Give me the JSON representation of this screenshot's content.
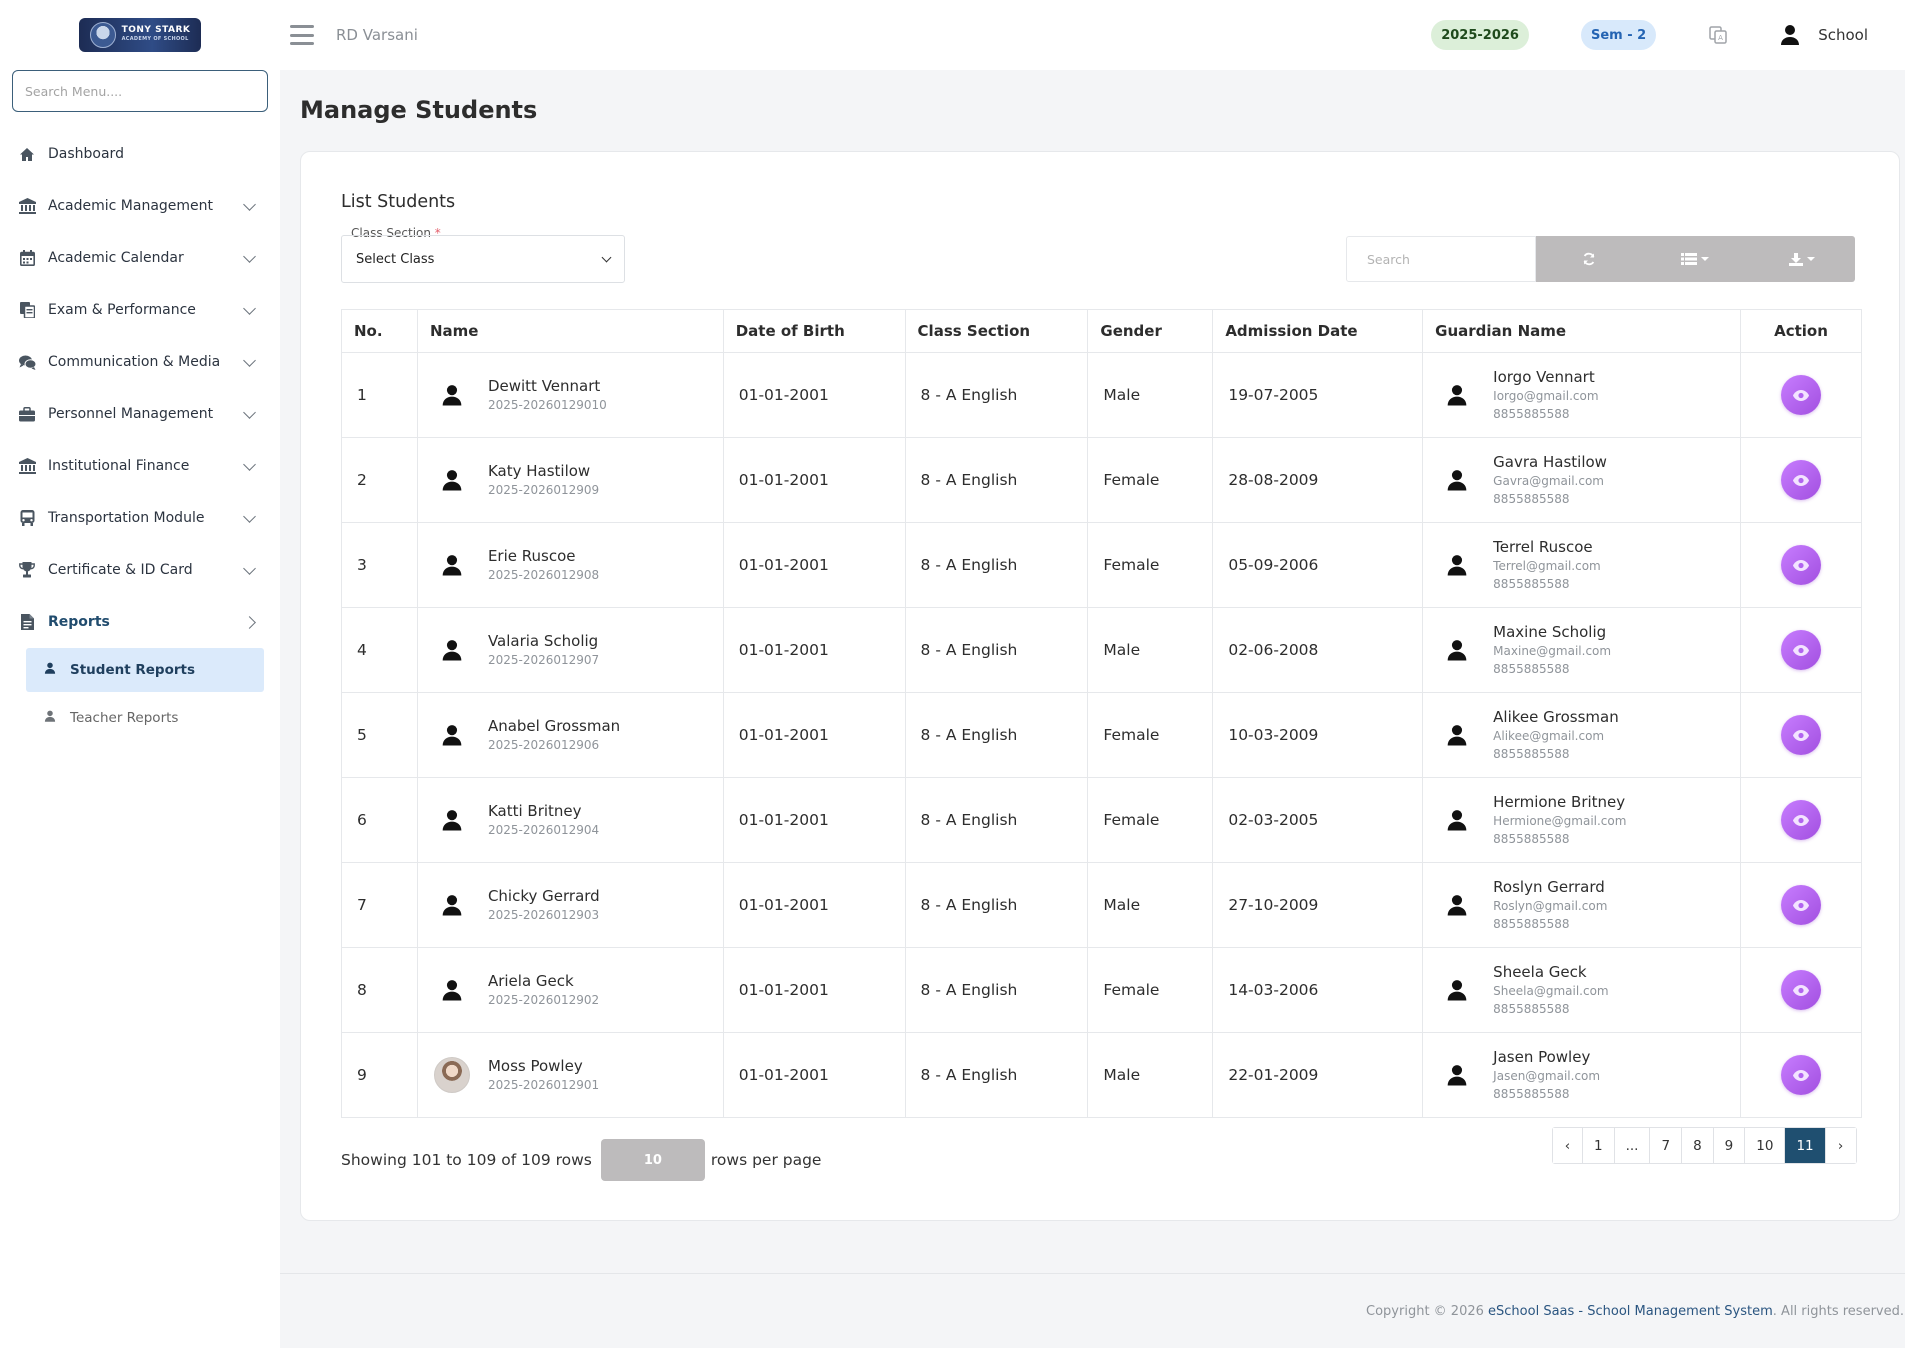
{
  "sidebar": {
    "logo": {
      "line1": "TONY STARK",
      "line2": "ACADEMY OF SCHOOL"
    },
    "search_placeholder": "Search Menu....",
    "items": [
      {
        "label": "Dashboard",
        "icon": "home-icon"
      },
      {
        "label": "Academic Management",
        "icon": "bank-icon"
      },
      {
        "label": "Academic Calendar",
        "icon": "calendar-icon"
      },
      {
        "label": "Exam & Performance",
        "icon": "copy-icon"
      },
      {
        "label": "Communication & Media",
        "icon": "chat-icon"
      },
      {
        "label": "Personnel Management",
        "icon": "briefcase-icon"
      },
      {
        "label": "Institutional Finance",
        "icon": "bank-icon"
      },
      {
        "label": "Transportation Module",
        "icon": "bus-icon"
      },
      {
        "label": "Certificate & ID Card",
        "icon": "trophy-icon"
      },
      {
        "label": "Reports",
        "icon": "file-icon"
      }
    ],
    "sub_items": [
      {
        "label": "Student Reports",
        "icon": "person-icon"
      },
      {
        "label": "Teacher Reports",
        "icon": "person-icon"
      }
    ]
  },
  "header": {
    "school": "RD Varsani",
    "year": "2025-2026",
    "semester": "Sem - 2",
    "user": "School"
  },
  "page": {
    "title": "Manage Students",
    "card_title": "List Students",
    "class_section_label": "Class Section",
    "required_mark": "*",
    "class_select_value": "Select Class",
    "search_placeholder": "Search"
  },
  "table": {
    "columns": [
      "No.",
      "Name",
      "Date of Birth",
      "Class Section",
      "Gender",
      "Admission Date",
      "Guardian Name",
      "Action"
    ],
    "rows": [
      {
        "no": "1",
        "name": "Dewitt Vennart",
        "id": "2025-20260129010",
        "dob": "01-01-2001",
        "class": "8 - A English",
        "gender": "Male",
        "admission": "19-07-2005",
        "guardian": "Iorgo Vennart",
        "email": "Iorgo@gmail.com",
        "phone": "8855885588"
      },
      {
        "no": "2",
        "name": "Katy Hastilow",
        "id": "2025-2026012909",
        "dob": "01-01-2001",
        "class": "8 - A English",
        "gender": "Female",
        "admission": "28-08-2009",
        "guardian": "Gavra Hastilow",
        "email": "Gavra@gmail.com",
        "phone": "8855885588"
      },
      {
        "no": "3",
        "name": "Erie Ruscoe",
        "id": "2025-2026012908",
        "dob": "01-01-2001",
        "class": "8 - A English",
        "gender": "Female",
        "admission": "05-09-2006",
        "guardian": "Terrel Ruscoe",
        "email": "Terrel@gmail.com",
        "phone": "8855885588"
      },
      {
        "no": "4",
        "name": "Valaria Scholig",
        "id": "2025-2026012907",
        "dob": "01-01-2001",
        "class": "8 - A English",
        "gender": "Male",
        "admission": "02-06-2008",
        "guardian": "Maxine Scholig",
        "email": "Maxine@gmail.com",
        "phone": "8855885588"
      },
      {
        "no": "5",
        "name": "Anabel Grossman",
        "id": "2025-2026012906",
        "dob": "01-01-2001",
        "class": "8 - A English",
        "gender": "Female",
        "admission": "10-03-2009",
        "guardian": "Alikee Grossman",
        "email": "Alikee@gmail.com",
        "phone": "8855885588"
      },
      {
        "no": "6",
        "name": "Katti Britney",
        "id": "2025-2026012904",
        "dob": "01-01-2001",
        "class": "8 - A English",
        "gender": "Female",
        "admission": "02-03-2005",
        "guardian": "Hermione Britney",
        "email": "Hermione@gmail.com",
        "phone": "8855885588"
      },
      {
        "no": "7",
        "name": "Chicky Gerrard",
        "id": "2025-2026012903",
        "dob": "01-01-2001",
        "class": "8 - A English",
        "gender": "Male",
        "admission": "27-10-2009",
        "guardian": "Roslyn Gerrard",
        "email": "Roslyn@gmail.com",
        "phone": "8855885588"
      },
      {
        "no": "8",
        "name": "Ariela Geck",
        "id": "2025-2026012902",
        "dob": "01-01-2001",
        "class": "8 - A English",
        "gender": "Female",
        "admission": "14-03-2006",
        "guardian": "Sheela Geck",
        "email": "Sheela@gmail.com",
        "phone": "8855885588"
      },
      {
        "no": "9",
        "name": "Moss Powley",
        "id": "2025-2026012901",
        "dob": "01-01-2001",
        "class": "8 - A English",
        "gender": "Male",
        "admission": "22-01-2009",
        "guardian": "Jasen Powley",
        "email": "Jasen@gmail.com",
        "phone": "8855885588"
      }
    ]
  },
  "pagination": {
    "showing": "Showing 101 to 109 of 109 rows",
    "rows_per_page_value": "10",
    "rows_per_page_label": "rows per page",
    "pages": [
      "‹",
      "1",
      "...",
      "7",
      "8",
      "9",
      "10",
      "11",
      "›"
    ],
    "active_page": "11"
  },
  "footer": {
    "prefix": "Copyright © 2026",
    "link": "eSchool Saas - School Management System",
    "suffix": ". All rights reserved."
  },
  "colors": {
    "accent": "#1f4f70",
    "view_button": "#b264f0",
    "toolbar_gray": "#bdbbbc",
    "active_menu_bg": "#dbeafb"
  }
}
